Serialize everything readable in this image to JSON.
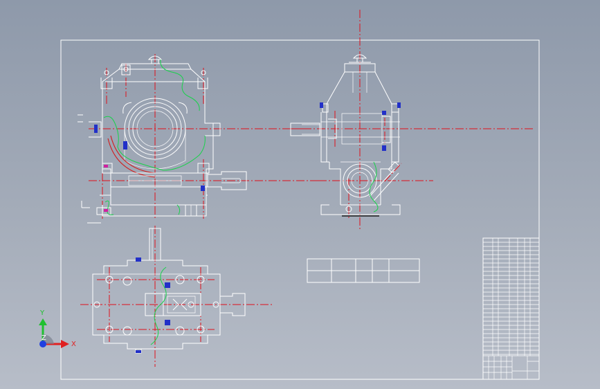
{
  "viewport": {
    "background_top": "#8e99aa",
    "background_bottom": "#b7bdc8"
  },
  "colors": {
    "outline": "#ffffff",
    "centerline": "#e0101a",
    "break_line": "#18d24a",
    "dimension_marker": "#2230c8",
    "axis_x": "#e02020",
    "axis_y": "#20c030",
    "axis_z": "#2040e0"
  },
  "triad": {
    "x_label": "X",
    "y_label": "Y",
    "z_label": "Z",
    "icon": "coordinate-triad-icon"
  }
}
